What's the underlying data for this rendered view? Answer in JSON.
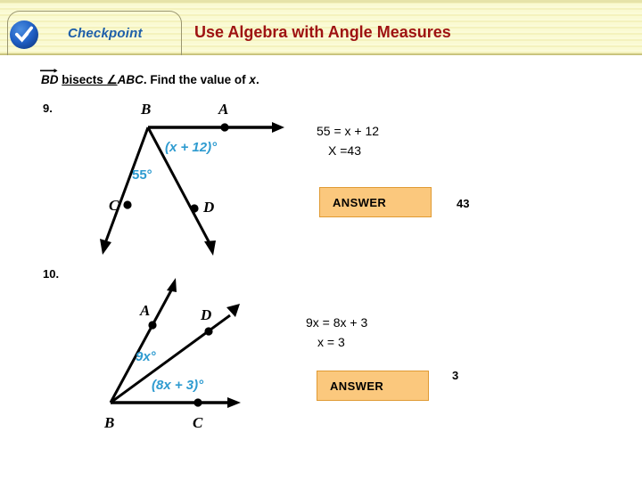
{
  "header": {
    "badge_icon": "check-circle-icon",
    "tab_label": "Checkpoint",
    "title": "Use Algebra with Angle Measures",
    "title_color": "#9e1212",
    "tab_label_color": "#1f5fa9",
    "band_color": "#fafad2"
  },
  "instruction": {
    "ray_text": "BD",
    "mid_text": "bisects ",
    "angle_symbol": "∠",
    "angle_name": "ABC",
    "tail_text": ". Find the value of ",
    "variable": "x",
    "period": "."
  },
  "problems": [
    {
      "number": "9.",
      "diagram": {
        "vertex_label": "B",
        "ray_labels": [
          "A",
          "C",
          "D"
        ],
        "angle_labels": [
          "(x + 12)°",
          "55°"
        ],
        "angle_label_color": "#2e9bd0"
      },
      "solution": {
        "line1": "55 = x + 12",
        "line2": "X =43"
      },
      "answer_label": "ANSWER",
      "answer_value": "43",
      "answer_box_color": "#fbc87d",
      "answer_border_color": "#e09a33"
    },
    {
      "number": "10.",
      "diagram": {
        "vertex_label": "B",
        "ray_labels": [
          "A",
          "D",
          "C"
        ],
        "angle_labels": [
          "9x°",
          "(8x + 3)°"
        ],
        "angle_label_color": "#2e9bd0"
      },
      "solution": {
        "line1": "9x = 8x + 3",
        "line2": "x = 3"
      },
      "answer_label": "ANSWER",
      "answer_value": "3",
      "answer_box_color": "#fbc87d",
      "answer_border_color": "#e09a33"
    }
  ]
}
